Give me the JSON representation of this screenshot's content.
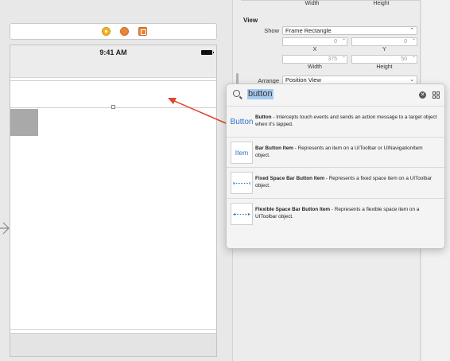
{
  "canvas": {
    "status_time": "9:41 AM"
  },
  "inspector": {
    "top_labels": {
      "width": "Width",
      "height": "Height"
    },
    "view_section": "View",
    "show_label": "Show",
    "show_value": "Frame Rectangle",
    "x_value": "0",
    "y_value": "0",
    "x_label": "X",
    "y_label": "Y",
    "width_value": "375",
    "height_value": "50",
    "width_label": "Width",
    "height_label": "Height",
    "arrange_label": "Arrange",
    "arrange_value": "Position View"
  },
  "library": {
    "search_value": "button",
    "items": [
      {
        "icon_text": "Button",
        "title": "Button",
        "desc": " - Intercepts touch events and sends an action message to a target object when it's tapped."
      },
      {
        "icon_text": "Item",
        "title": "Bar Button Item",
        "desc": " - Represents an item on a UIToolbar or UINavigationItem object."
      },
      {
        "icon_text": "",
        "title": "Fixed Space Bar Button Item",
        "desc": " - Represents a fixed space item on a UIToolbar object."
      },
      {
        "icon_text": "",
        "title": "Flexible Space Bar Button Item",
        "desc": " - Represents a flexible space item on a UIToolbar object."
      }
    ]
  },
  "colors": {
    "accent": "#2f73c8",
    "highlight": "#a7c9f0",
    "arrow": "#e0452f"
  }
}
